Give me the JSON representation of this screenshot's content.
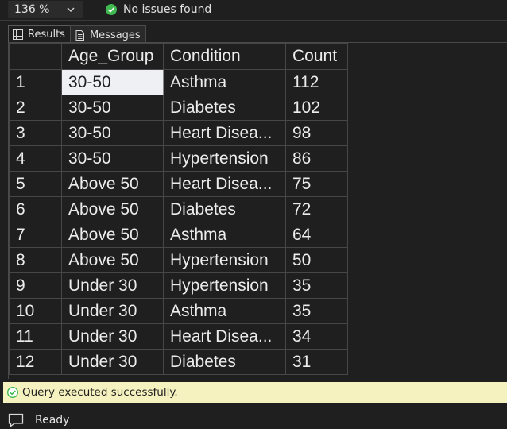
{
  "toolbar": {
    "zoom": "136 %",
    "issues_text": "No issues found"
  },
  "tabs": [
    {
      "label": "Results"
    },
    {
      "label": "Messages"
    }
  ],
  "grid": {
    "columns": [
      "",
      "Age_Group",
      "Condition",
      "Count"
    ],
    "rows": [
      [
        "1",
        "30-50",
        "Asthma",
        "112"
      ],
      [
        "2",
        "30-50",
        "Diabetes",
        "102"
      ],
      [
        "3",
        "30-50",
        "Heart Disea...",
        "98"
      ],
      [
        "4",
        "30-50",
        "Hypertension",
        "86"
      ],
      [
        "5",
        "Above 50",
        "Heart Disea...",
        "75"
      ],
      [
        "6",
        "Above 50",
        "Diabetes",
        "72"
      ],
      [
        "7",
        "Above 50",
        "Asthma",
        "64"
      ],
      [
        "8",
        "Above 50",
        "Hypertension",
        "50"
      ],
      [
        "9",
        "Under 30",
        "Hypertension",
        "35"
      ],
      [
        "10",
        "Under 30",
        "Asthma",
        "35"
      ],
      [
        "11",
        "Under 30",
        "Heart Disea...",
        "34"
      ],
      [
        "12",
        "Under 30",
        "Diabetes",
        "31"
      ]
    ]
  },
  "status": {
    "query": "Query executed successfully.",
    "ready": "Ready"
  },
  "colors": {
    "success_green": "#3fb950",
    "status_bg": "#f6f2c0"
  }
}
